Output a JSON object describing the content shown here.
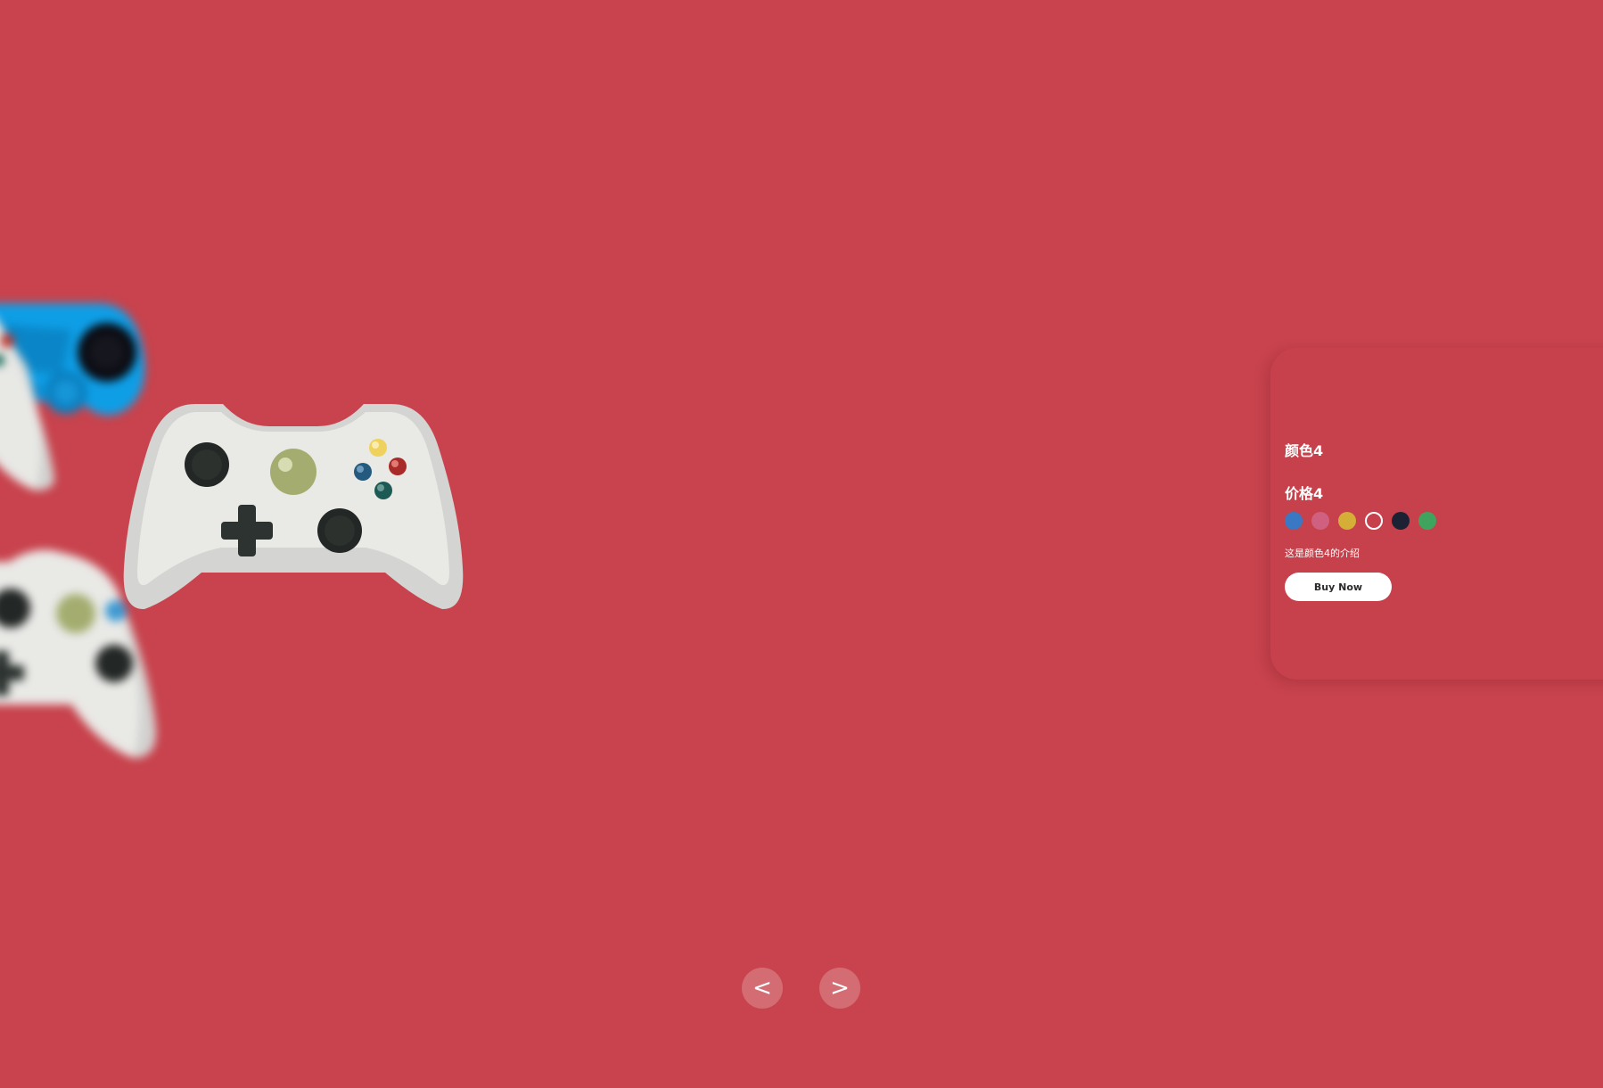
{
  "product": {
    "title": "颜色4",
    "price": "价格4",
    "description": "这是颜色4的介绍",
    "buy_label": "Buy Now",
    "swatches": [
      {
        "color": "#3a78c3",
        "selected": false
      },
      {
        "color": "#d0607f",
        "selected": false
      },
      {
        "color": "#d4ae37",
        "selected": false
      },
      {
        "color": "#c6414b",
        "selected": true
      },
      {
        "color": "#1c2233",
        "selected": false
      },
      {
        "color": "#3fa55e",
        "selected": false
      }
    ]
  },
  "navigation": {
    "prev_label": "<",
    "next_label": ">"
  },
  "colors": {
    "background": "#c8434d",
    "card": "#c6414b",
    "button_bg": "#ffffff",
    "button_text": "#2b2b2b"
  },
  "icons": {
    "main": "white-gamepad-icon",
    "background": [
      "blue-gamepad-icon",
      "white-gamepad-icon",
      "white-gamepad-icon"
    ]
  }
}
